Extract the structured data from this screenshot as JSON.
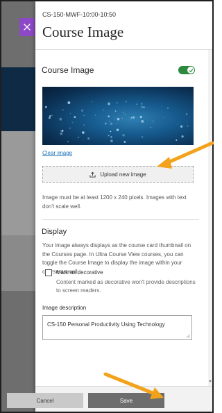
{
  "panel": {
    "course_code": "CS-150-MWF-10:00-10:50",
    "title": "Course Image"
  },
  "course_image": {
    "section_title": "Course Image",
    "toggle_on": true,
    "clear_link": "Clear image",
    "upload_label": "Upload new image",
    "help_text": "Image must be at least 1200 x 240 pixels. Images with text don't scale well."
  },
  "display": {
    "section_title": "Display",
    "text": "Your image always displays as the course card thumbnail on the Courses page. In Ultra Course View courses, you can toggle the Course Image to display the image within your course as well."
  },
  "decorative": {
    "label": "Mark as decorative",
    "help": "Content marked as decorative won't provide descriptions to screen readers.",
    "checked": false
  },
  "description": {
    "label": "Image description",
    "value": "CS-150 Personal Productivity Using Technology"
  },
  "footer": {
    "cancel_label": "Cancel",
    "save_label": "Save"
  },
  "colors": {
    "accent_purple": "#8c48c6",
    "toggle_green": "#2b8a3e",
    "annotation_arrow": "#f2a31b"
  }
}
